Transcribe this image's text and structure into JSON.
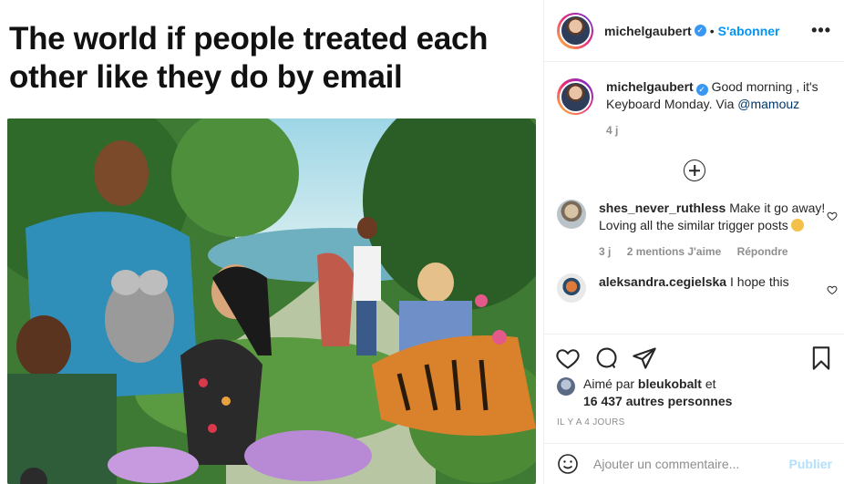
{
  "media": {
    "caption_line1": "The world if people treated each",
    "caption_line2": "other like they do by email"
  },
  "header": {
    "username": "michelgaubert",
    "verified_icon": "verified-badge-icon",
    "separator": "•",
    "follow_label": "S'abonner",
    "more_label": "•••"
  },
  "post": {
    "username": "michelgaubert",
    "text_before": "Good morning , it's Keyboard Monday. Via ",
    "mention": "@mamouz",
    "age": "4 j"
  },
  "comments": [
    {
      "username": "shes_never_ruthless",
      "text": "Make it go away! Loving all the similar trigger posts",
      "age": "3 j",
      "likes": "2 mentions J'aime",
      "reply": "Répondre"
    },
    {
      "username": "aleksandra.cegielska",
      "text": "I hope this"
    }
  ],
  "likes": {
    "prefix": "Aimé par ",
    "user": "bleukobalt",
    "mid": " et",
    "others": "16 437 autres personnes"
  },
  "timestamp": "IL Y A 4 JOURS",
  "add_comment": {
    "placeholder": "Ajouter un commentaire...",
    "post_label": "Publier"
  },
  "colors": {
    "accent": "#0095f6",
    "verified": "#3897f0",
    "muted": "#8e8e8e",
    "publish_disabled": "#b2dffc"
  }
}
